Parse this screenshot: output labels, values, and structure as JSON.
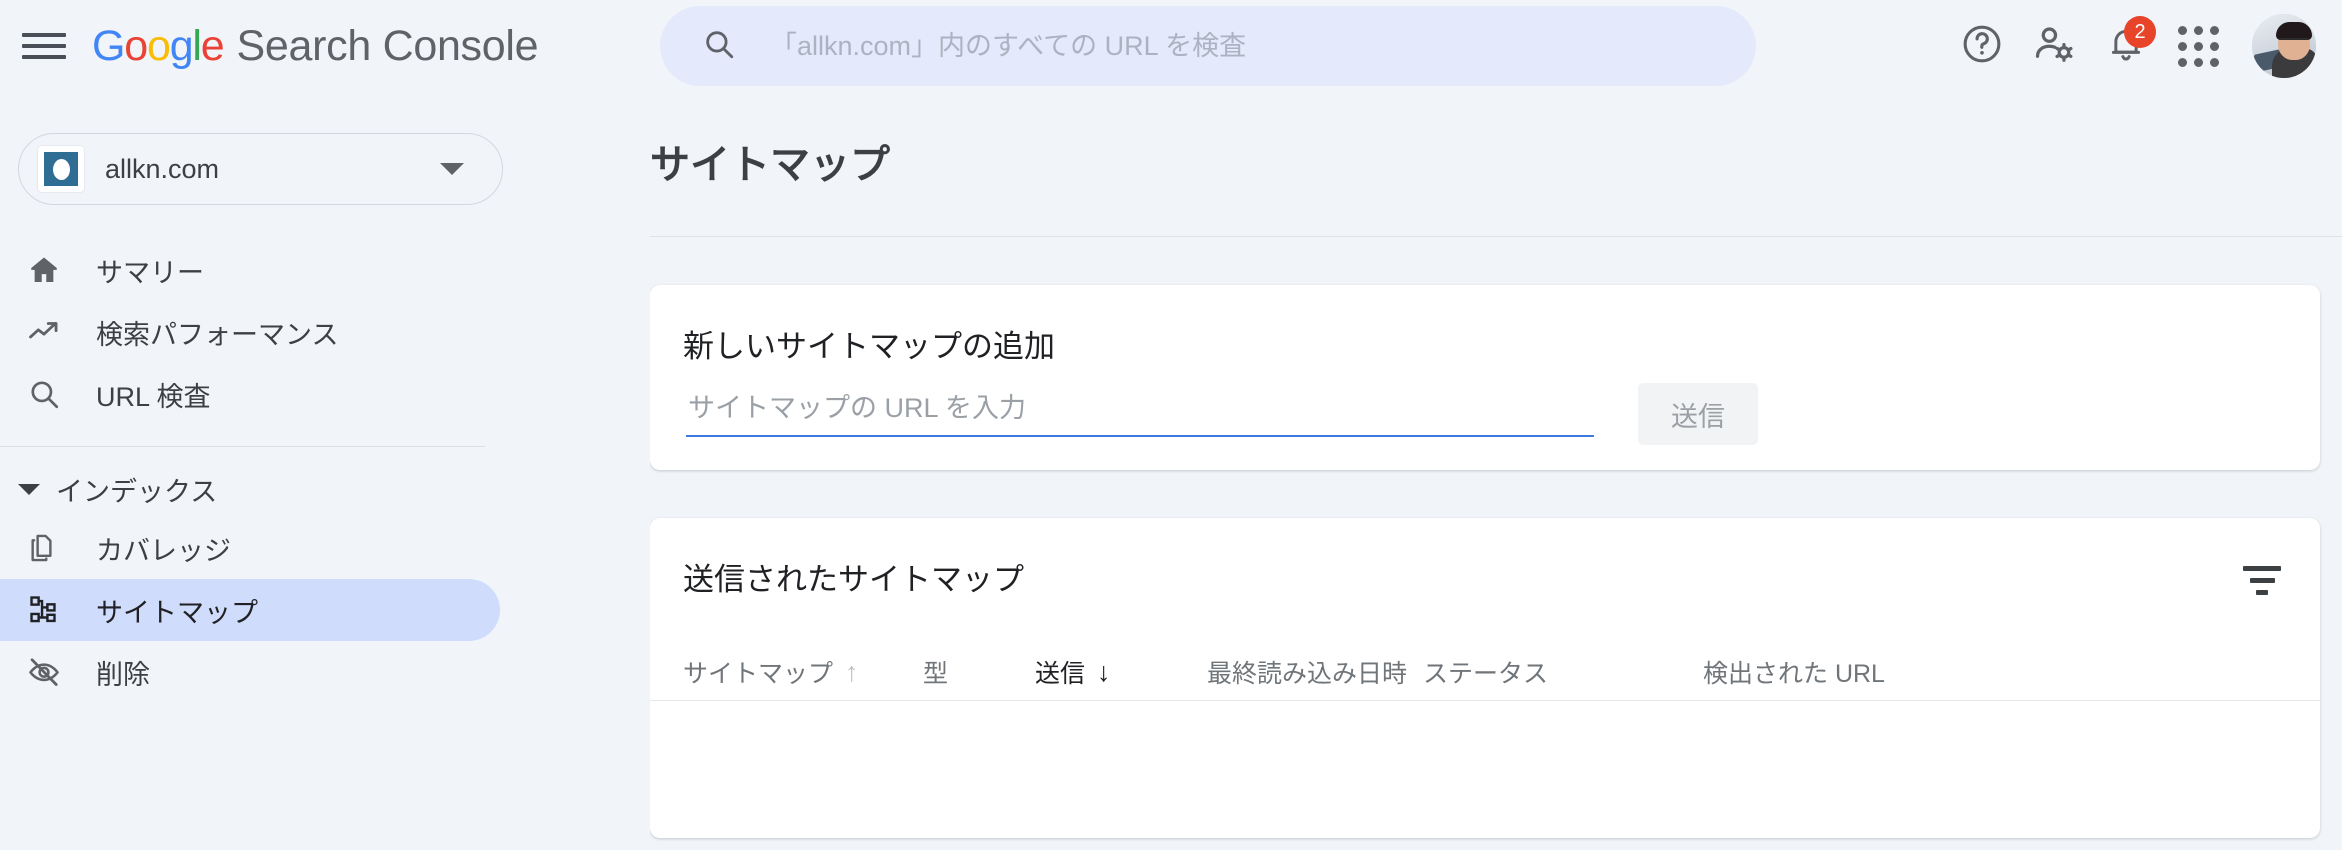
{
  "app": {
    "brand_google": "Google",
    "brand_product": "Search Console",
    "menu_icon": "hamburger-icon"
  },
  "search": {
    "placeholder": "「allkn.com」内のすべての URL を検査",
    "value": "",
    "icon": "search-icon"
  },
  "topbar_actions": {
    "help": "help-icon",
    "account_settings": "person-gear-icon",
    "notifications": "bell-icon",
    "notification_count": "2",
    "apps": "apps-grid-icon",
    "avatar": "user-avatar"
  },
  "property": {
    "name": "allkn.com",
    "favicon": "site-favicon",
    "caret": "chevron-down-icon"
  },
  "sidebar": {
    "items": [
      {
        "label": "サマリー",
        "icon": "home-icon",
        "active": false
      },
      {
        "label": "検索パフォーマンス",
        "icon": "trending-up-icon",
        "active": false
      },
      {
        "label": "URL 検査",
        "icon": "search-icon",
        "active": false
      }
    ],
    "section": {
      "title": "インデックス",
      "expanded": true,
      "caret": "caret-down-icon",
      "items": [
        {
          "label": "カバレッジ",
          "icon": "coverage-pages-icon",
          "active": false
        },
        {
          "label": "サイトマップ",
          "icon": "sitemap-icon",
          "active": true
        },
        {
          "label": "削除",
          "icon": "eye-off-icon",
          "active": false
        }
      ]
    }
  },
  "main": {
    "page_title": "サイトマップ",
    "add_card": {
      "title": "新しいサイトマップの追加",
      "input_placeholder": "サイトマップの URL を入力",
      "input_value": "",
      "submit_label": "送信",
      "submit_disabled": true
    },
    "list_card": {
      "title": "送信されたサイトマップ",
      "filter_icon": "filter-icon",
      "columns": [
        {
          "label": "サイトマップ",
          "sort": "asc",
          "sorted": false
        },
        {
          "label": "型",
          "sort": "none",
          "sorted": false
        },
        {
          "label": "送信",
          "sort": "desc",
          "sorted": true
        },
        {
          "label": "最終読み込み日時",
          "sort": "none",
          "sorted": false
        },
        {
          "label": "ステータス",
          "sort": "none",
          "sorted": false
        },
        {
          "label": "検出された URL",
          "sort": "none",
          "sorted": false
        }
      ],
      "rows": []
    }
  },
  "colors": {
    "page_bg": "#f1f4f9",
    "card_bg": "#ffffff",
    "accent_blue": "#3f78e0",
    "active_nav_bg": "#cfdcfb",
    "search_bg": "#e4eafb",
    "badge_red": "#e8442a",
    "text_primary": "#3c4043",
    "text_secondary": "#70757a",
    "google_blue": "#4285f4",
    "google_red": "#ea4335",
    "google_yellow": "#fbbc05",
    "google_green": "#34a853"
  },
  "sort_glyphs": {
    "asc": "↑",
    "desc": "↓",
    "none": ""
  }
}
